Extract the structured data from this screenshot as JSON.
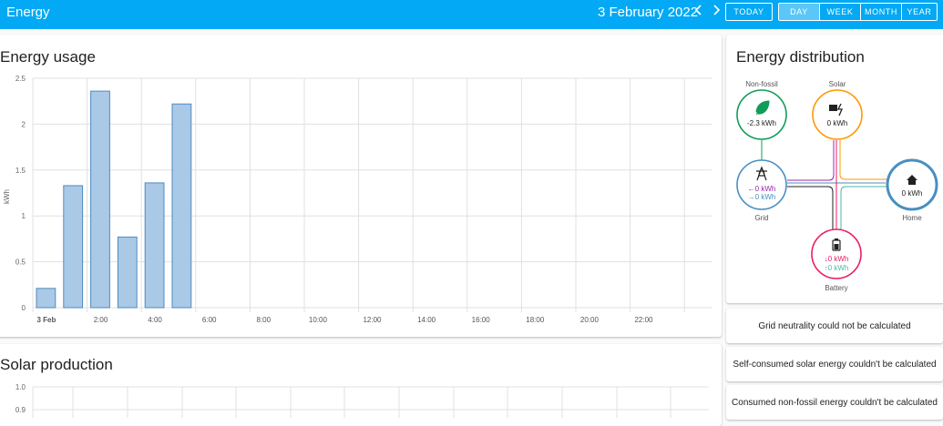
{
  "header": {
    "title": "Energy",
    "date": "3 February 2022",
    "prev_icon": "chevron-left-icon",
    "next_icon": "chevron-right-icon",
    "today_label": "TODAY",
    "periods": [
      "DAY",
      "WEEK",
      "MONTH",
      "YEAR"
    ],
    "active_period": "DAY"
  },
  "usage_card": {
    "title": "Energy usage",
    "bar_color": "#a9c9e6",
    "bar_stroke": "#4f8bbf",
    "chart_data": {
      "type": "bar",
      "title": "Energy usage",
      "ylabel": "kWh",
      "ylim": [
        0,
        2.5
      ],
      "y_ticks": [
        "0",
        "0.5",
        "1",
        "1.5",
        "2",
        "2.5"
      ],
      "x_ticks": [
        "3 Feb",
        "2:00",
        "4:00",
        "6:00",
        "8:00",
        "10:00",
        "12:00",
        "14:00",
        "16:00",
        "18:00",
        "20:00",
        "22:00"
      ],
      "categories": [
        "0:00",
        "1:00",
        "2:00",
        "3:00",
        "4:00",
        "5:00"
      ],
      "values": [
        0.21,
        1.33,
        2.36,
        0.77,
        1.36,
        2.22
      ]
    }
  },
  "solar_card": {
    "title": "Solar production",
    "y_ticks": [
      "1.0",
      "0.9"
    ]
  },
  "distribution": {
    "title": "Energy distribution",
    "non_fossil": {
      "label": "Non-fossil",
      "value": "-2.3 kWh",
      "color": "#0f9d58",
      "icon": "leaf-icon"
    },
    "solar": {
      "label": "Solar",
      "value": "0 kWh",
      "color": "#ff9800",
      "icon": "solar-panel-icon"
    },
    "grid": {
      "label": "Grid",
      "value_in": "←0 kWh",
      "value_out": "→0 kWh",
      "color": "#488fc2",
      "icon": "transmission-tower-icon"
    },
    "home": {
      "label": "Home",
      "value": "0 kWh",
      "color": "#488fc2",
      "icon": "home-icon"
    },
    "battery": {
      "label": "Battery",
      "value_in": "↓0 kWh",
      "value_out": "↑0 kWh",
      "color": "#e91e63",
      "icon": "battery-icon"
    }
  },
  "info_cards": [
    "Grid neutrality could not be calculated",
    "Self-consumed solar energy couldn't be calculated",
    "Consumed non-fossil energy couldn't be calculated"
  ]
}
